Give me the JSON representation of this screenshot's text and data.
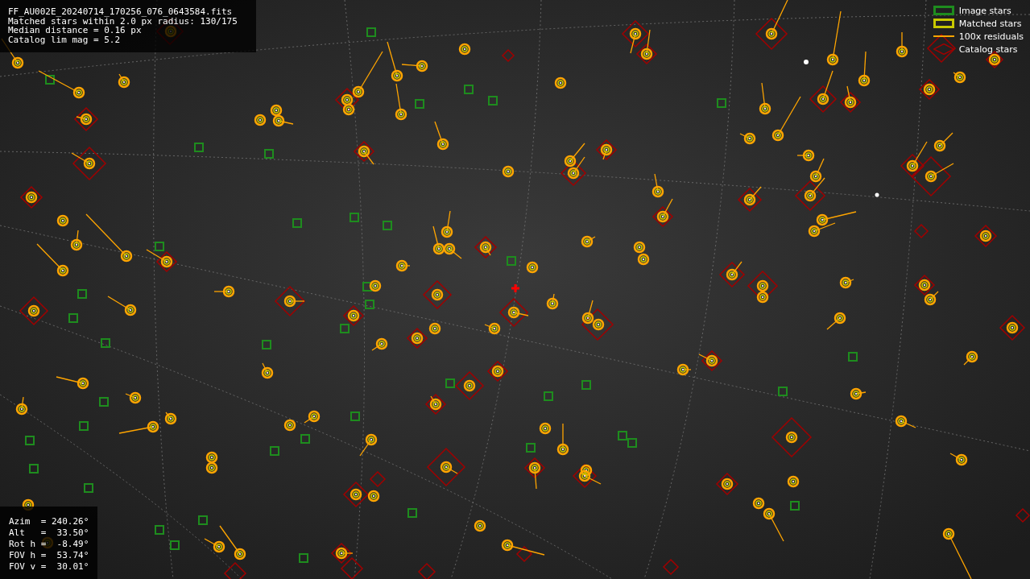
{
  "info_panel": {
    "lines": [
      "FF_AU002E_20240714_170256_076_0643584.fits",
      "Matched stars within 2.0 px radius: 130/175",
      "Median distance = 0.16 px",
      "Catalog lim mag = 5.2"
    ]
  },
  "legend": [
    {
      "kind": "image",
      "label": "Image stars",
      "color": "#1e8c1e"
    },
    {
      "kind": "matched",
      "label": "Matched stars",
      "color": "#c8c800"
    },
    {
      "kind": "residual",
      "label": "100x residuals",
      "color": "#ffa500"
    },
    {
      "kind": "catalog",
      "label": "Catalog stars",
      "color": "#a00000"
    }
  ],
  "pointing_panel": {
    "lines": [
      "Azim  = 240.26°",
      "Alt   =  33.50°",
      "Rot h =  -8.49°",
      "FOV h =  53.74°",
      "FOV v =  30.01°"
    ]
  }
}
